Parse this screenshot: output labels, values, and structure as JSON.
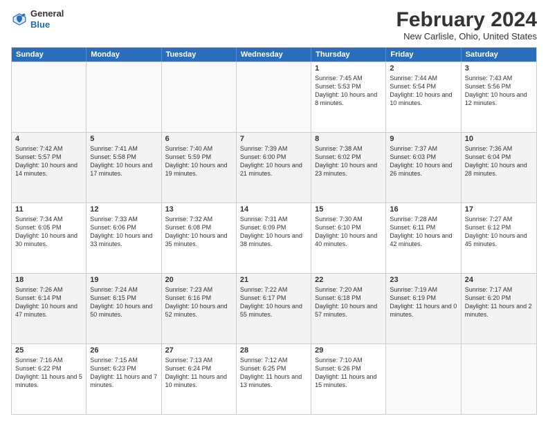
{
  "logo": {
    "line1": "General",
    "line2": "Blue"
  },
  "calendar": {
    "title": "February 2024",
    "subtitle": "New Carlisle, Ohio, United States",
    "days": [
      "Sunday",
      "Monday",
      "Tuesday",
      "Wednesday",
      "Thursday",
      "Friday",
      "Saturday"
    ],
    "weeks": [
      [
        {
          "date": "",
          "sunrise": "",
          "sunset": "",
          "daylight": ""
        },
        {
          "date": "",
          "sunrise": "",
          "sunset": "",
          "daylight": ""
        },
        {
          "date": "",
          "sunrise": "",
          "sunset": "",
          "daylight": ""
        },
        {
          "date": "",
          "sunrise": "",
          "sunset": "",
          "daylight": ""
        },
        {
          "date": "1",
          "sunrise": "Sunrise: 7:45 AM",
          "sunset": "Sunset: 5:53 PM",
          "daylight": "Daylight: 10 hours and 8 minutes."
        },
        {
          "date": "2",
          "sunrise": "Sunrise: 7:44 AM",
          "sunset": "Sunset: 5:54 PM",
          "daylight": "Daylight: 10 hours and 10 minutes."
        },
        {
          "date": "3",
          "sunrise": "Sunrise: 7:43 AM",
          "sunset": "Sunset: 5:56 PM",
          "daylight": "Daylight: 10 hours and 12 minutes."
        }
      ],
      [
        {
          "date": "4",
          "sunrise": "Sunrise: 7:42 AM",
          "sunset": "Sunset: 5:57 PM",
          "daylight": "Daylight: 10 hours and 14 minutes."
        },
        {
          "date": "5",
          "sunrise": "Sunrise: 7:41 AM",
          "sunset": "Sunset: 5:58 PM",
          "daylight": "Daylight: 10 hours and 17 minutes."
        },
        {
          "date": "6",
          "sunrise": "Sunrise: 7:40 AM",
          "sunset": "Sunset: 5:59 PM",
          "daylight": "Daylight: 10 hours and 19 minutes."
        },
        {
          "date": "7",
          "sunrise": "Sunrise: 7:39 AM",
          "sunset": "Sunset: 6:00 PM",
          "daylight": "Daylight: 10 hours and 21 minutes."
        },
        {
          "date": "8",
          "sunrise": "Sunrise: 7:38 AM",
          "sunset": "Sunset: 6:02 PM",
          "daylight": "Daylight: 10 hours and 23 minutes."
        },
        {
          "date": "9",
          "sunrise": "Sunrise: 7:37 AM",
          "sunset": "Sunset: 6:03 PM",
          "daylight": "Daylight: 10 hours and 26 minutes."
        },
        {
          "date": "10",
          "sunrise": "Sunrise: 7:36 AM",
          "sunset": "Sunset: 6:04 PM",
          "daylight": "Daylight: 10 hours and 28 minutes."
        }
      ],
      [
        {
          "date": "11",
          "sunrise": "Sunrise: 7:34 AM",
          "sunset": "Sunset: 6:05 PM",
          "daylight": "Daylight: 10 hours and 30 minutes."
        },
        {
          "date": "12",
          "sunrise": "Sunrise: 7:33 AM",
          "sunset": "Sunset: 6:06 PM",
          "daylight": "Daylight: 10 hours and 33 minutes."
        },
        {
          "date": "13",
          "sunrise": "Sunrise: 7:32 AM",
          "sunset": "Sunset: 6:08 PM",
          "daylight": "Daylight: 10 hours and 35 minutes."
        },
        {
          "date": "14",
          "sunrise": "Sunrise: 7:31 AM",
          "sunset": "Sunset: 6:09 PM",
          "daylight": "Daylight: 10 hours and 38 minutes."
        },
        {
          "date": "15",
          "sunrise": "Sunrise: 7:30 AM",
          "sunset": "Sunset: 6:10 PM",
          "daylight": "Daylight: 10 hours and 40 minutes."
        },
        {
          "date": "16",
          "sunrise": "Sunrise: 7:28 AM",
          "sunset": "Sunset: 6:11 PM",
          "daylight": "Daylight: 10 hours and 42 minutes."
        },
        {
          "date": "17",
          "sunrise": "Sunrise: 7:27 AM",
          "sunset": "Sunset: 6:12 PM",
          "daylight": "Daylight: 10 hours and 45 minutes."
        }
      ],
      [
        {
          "date": "18",
          "sunrise": "Sunrise: 7:26 AM",
          "sunset": "Sunset: 6:14 PM",
          "daylight": "Daylight: 10 hours and 47 minutes."
        },
        {
          "date": "19",
          "sunrise": "Sunrise: 7:24 AM",
          "sunset": "Sunset: 6:15 PM",
          "daylight": "Daylight: 10 hours and 50 minutes."
        },
        {
          "date": "20",
          "sunrise": "Sunrise: 7:23 AM",
          "sunset": "Sunset: 6:16 PM",
          "daylight": "Daylight: 10 hours and 52 minutes."
        },
        {
          "date": "21",
          "sunrise": "Sunrise: 7:22 AM",
          "sunset": "Sunset: 6:17 PM",
          "daylight": "Daylight: 10 hours and 55 minutes."
        },
        {
          "date": "22",
          "sunrise": "Sunrise: 7:20 AM",
          "sunset": "Sunset: 6:18 PM",
          "daylight": "Daylight: 10 hours and 57 minutes."
        },
        {
          "date": "23",
          "sunrise": "Sunrise: 7:19 AM",
          "sunset": "Sunset: 6:19 PM",
          "daylight": "Daylight: 11 hours and 0 minutes."
        },
        {
          "date": "24",
          "sunrise": "Sunrise: 7:17 AM",
          "sunset": "Sunset: 6:20 PM",
          "daylight": "Daylight: 11 hours and 2 minutes."
        }
      ],
      [
        {
          "date": "25",
          "sunrise": "Sunrise: 7:16 AM",
          "sunset": "Sunset: 6:22 PM",
          "daylight": "Daylight: 11 hours and 5 minutes."
        },
        {
          "date": "26",
          "sunrise": "Sunrise: 7:15 AM",
          "sunset": "Sunset: 6:23 PM",
          "daylight": "Daylight: 11 hours and 7 minutes."
        },
        {
          "date": "27",
          "sunrise": "Sunrise: 7:13 AM",
          "sunset": "Sunset: 6:24 PM",
          "daylight": "Daylight: 11 hours and 10 minutes."
        },
        {
          "date": "28",
          "sunrise": "Sunrise: 7:12 AM",
          "sunset": "Sunset: 6:25 PM",
          "daylight": "Daylight: 11 hours and 13 minutes."
        },
        {
          "date": "29",
          "sunrise": "Sunrise: 7:10 AM",
          "sunset": "Sunset: 6:26 PM",
          "daylight": "Daylight: 11 hours and 15 minutes."
        },
        {
          "date": "",
          "sunrise": "",
          "sunset": "",
          "daylight": ""
        },
        {
          "date": "",
          "sunrise": "",
          "sunset": "",
          "daylight": ""
        }
      ]
    ]
  }
}
